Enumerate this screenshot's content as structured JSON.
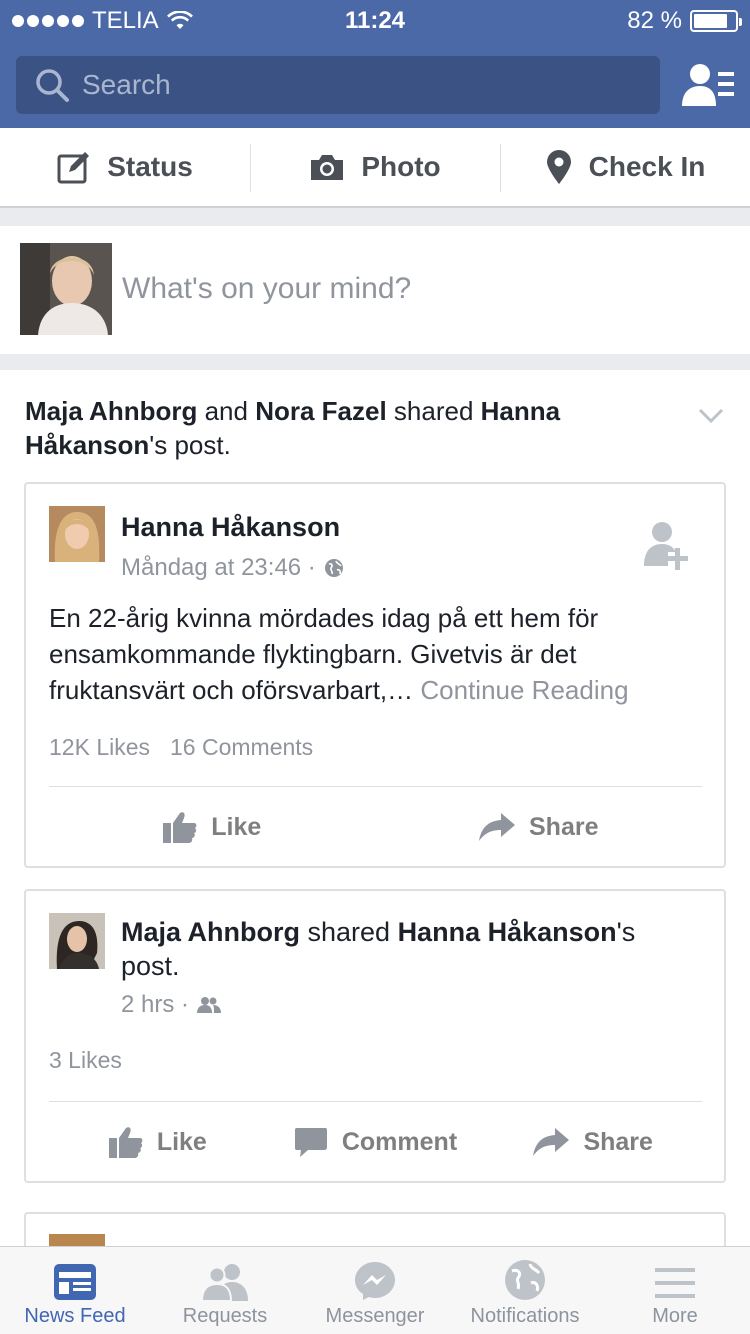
{
  "status_bar": {
    "carrier": "TELIA",
    "time": "11:24",
    "battery_percent": "82 %",
    "battery_level": 0.82
  },
  "search": {
    "placeholder": "Search"
  },
  "composer": {
    "actions": [
      {
        "label": "Status",
        "icon": "edit-icon"
      },
      {
        "label": "Photo",
        "icon": "camera-icon"
      },
      {
        "label": "Check In",
        "icon": "location-pin-icon"
      }
    ],
    "prompt": "What's on your mind?"
  },
  "story": {
    "header": {
      "actor1": "Maja Ahnborg",
      "and": " and ",
      "actor2": "Nora Fazel",
      "shared": " shared ",
      "owner": "Hanna Håkanson",
      "suffix": "'s post."
    },
    "original_post": {
      "author": "Hanna Håkanson",
      "timestamp": "Måndag at 23:46 ·",
      "body": "En 22-årig kvinna mördades idag på ett hem för ensamkommande flyktingbarn. Givetvis är det fruktansvärt och oförsvarbart,…",
      "continue": "Continue Reading",
      "likes": "12K Likes",
      "comments": "16 Comments",
      "actions": {
        "like": "Like",
        "share": "Share"
      }
    },
    "share_post": {
      "actor": "Maja Ahnborg",
      "shared": " shared ",
      "owner": "Hanna Håkanson",
      "suffix": "'s post.",
      "timestamp": "2 hrs ·",
      "likes": "3 Likes",
      "actions": {
        "like": "Like",
        "comment": "Comment",
        "share": "Share"
      }
    }
  },
  "tabs": [
    {
      "label": "News Feed",
      "icon": "news-feed-icon",
      "active": true
    },
    {
      "label": "Requests",
      "icon": "friends-icon"
    },
    {
      "label": "Messenger",
      "icon": "messenger-icon"
    },
    {
      "label": "Notifications",
      "icon": "globe-icon"
    },
    {
      "label": "More",
      "icon": "menu-icon"
    }
  ]
}
